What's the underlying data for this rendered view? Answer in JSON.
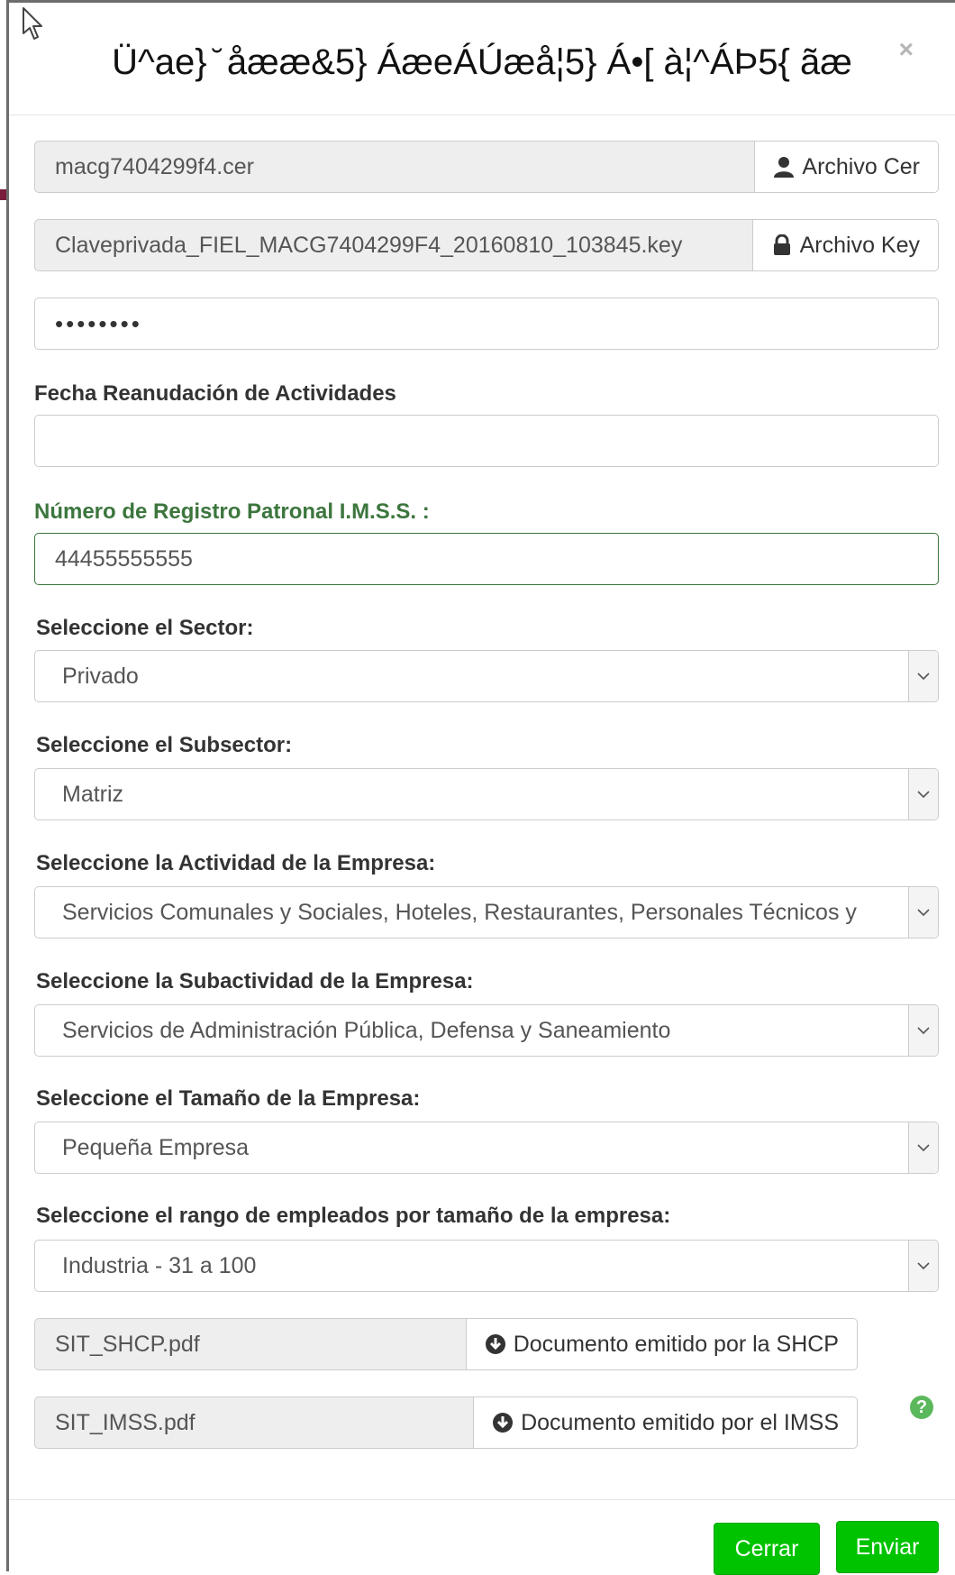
{
  "modal": {
    "title": "Ü^ae} ̆ åææ&5} ÁæeÁÚæå¦5} Á•[ à¦^ÁÞ5{ ãæ",
    "close_glyph": "×"
  },
  "files": {
    "cer_value": "macg7404299f4.cer",
    "cer_button": "Archivo Cer",
    "key_value": "Claveprivada_FIEL_MACG7404299F4_20160810_103845.key",
    "key_button": "Archivo Key",
    "password_value": "••••••••"
  },
  "form": {
    "fecha_label": "Fecha Reanudación de Actividades",
    "fecha_value": "",
    "registro_label": "Número de Registro Patronal I.M.S.S. :",
    "registro_value": "44455555555",
    "sector_label": "Seleccione el Sector:",
    "sector_value": "Privado",
    "subsector_label": "Seleccione el Subsector:",
    "subsector_value": "Matriz",
    "actividad_label": "Seleccione la Actividad de la Empresa:",
    "actividad_value": "Servicios Comunales y Sociales, Hoteles, Restaurantes, Personales Técnicos y",
    "subactividad_label": "Seleccione la Subactividad de la Empresa:",
    "subactividad_value": "Servicios de Administración Pública, Defensa y Saneamiento",
    "tamano_label": "Seleccione el Tamaño de la Empresa:",
    "tamano_value": "Pequeña Empresa",
    "rango_label": "Seleccione el rango de empleados por tamaño de la empresa:",
    "rango_value": "Industria - 31 a 100"
  },
  "documents": {
    "shcp_file": "SIT_SHCP.pdf",
    "shcp_button": "Documento emitido por la SHCP",
    "imss_file": "SIT_IMSS.pdf",
    "imss_button": "Documento emitido por el IMSS",
    "help_glyph": "?"
  },
  "footer": {
    "cerrar": "Cerrar",
    "enviar": "Enviar"
  },
  "colors": {
    "accent_green": "#00c300",
    "valid_green": "#3c763d"
  }
}
